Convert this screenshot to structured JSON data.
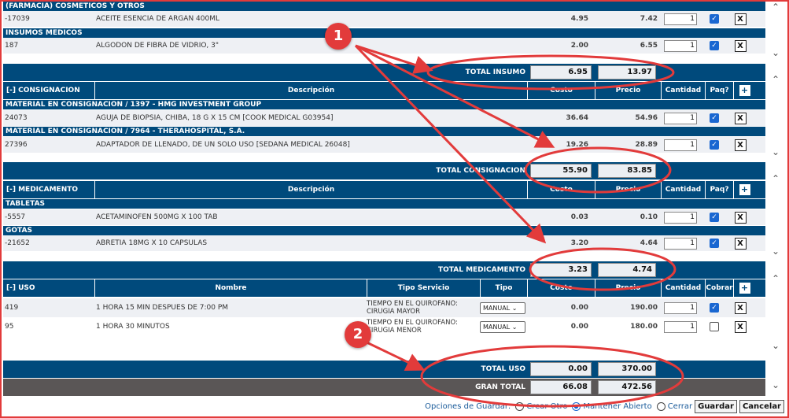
{
  "sections": {
    "cosmeticos": {
      "category": "(FARMACIA) COSMETICOS Y OTROS",
      "items": [
        {
          "code": "-17039",
          "desc": "ACEITE ESENCIA DE ARGAN 400ML",
          "cost": "4.95",
          "price": "7.42",
          "qty": "1",
          "paq": true
        }
      ]
    },
    "insumos": {
      "category": "INSUMOS MEDICOS",
      "items": [
        {
          "code": "187",
          "desc": "ALGODON DE FIBRA DE VIDRIO, 3\"",
          "cost": "2.00",
          "price": "6.55",
          "qty": "1",
          "paq": true
        }
      ],
      "total_label": "TOTAL INSUMO",
      "total_cost": "6.95",
      "total_price": "13.97"
    },
    "consignacion": {
      "header": [
        "[-] CONSIGNACION",
        "Descripción",
        "Costo",
        "Precio",
        "Cantidad",
        "Paq?",
        "+"
      ],
      "groups": [
        {
          "category": "MATERIAL EN CONSIGNACION / 1397 - HMG INVESTMENT GROUP",
          "item": {
            "code": "24073",
            "desc": "AGUJA DE BIOPSIA, CHIBA, 18 G X 15 CM [COOK MEDICAL G03954]",
            "cost": "36.64",
            "price": "54.96",
            "qty": "1",
            "paq": true
          }
        },
        {
          "category": "MATERIAL EN CONSIGNACION / 7964 - THERAHOSPITAL, S.A.",
          "item": {
            "code": "27396",
            "desc": "ADAPTADOR DE LLENADO, DE UN SOLO USO [SEDANA MEDICAL 26048]",
            "cost": "19.26",
            "price": "28.89",
            "qty": "1",
            "paq": true
          }
        }
      ],
      "total_label": "TOTAL CONSIGNACION",
      "total_cost": "55.90",
      "total_price": "83.85"
    },
    "medicamento": {
      "header": [
        "[-] MEDICAMENTO",
        "Descripción",
        "Costo",
        "Precio",
        "Cantidad",
        "Paq?",
        "+"
      ],
      "groups": [
        {
          "category": "TABLETAS",
          "item": {
            "code": "-5557",
            "desc": "ACETAMINOFEN 500MG X 100 TAB",
            "cost": "0.03",
            "price": "0.10",
            "qty": "1",
            "paq": true
          }
        },
        {
          "category": "GOTAS",
          "item": {
            "code": "-21652",
            "desc": "ABRETIA 18MG X 10 CAPSULAS",
            "cost": "3.20",
            "price": "4.64",
            "qty": "1",
            "paq": true
          }
        }
      ],
      "total_label": "TOTAL MEDICAMENTO",
      "total_cost": "3.23",
      "total_price": "4.74"
    },
    "uso": {
      "header": [
        "[-] USO",
        "Nombre",
        "Tipo Servicio",
        "Tipo",
        "Costo",
        "Precio",
        "Cantidad",
        "Cobrar",
        "+"
      ],
      "items": [
        {
          "code": "419",
          "name": "1 HORA 15 MIN DESPUES DE 7:00 PM",
          "service_1": "TIEMPO EN EL QUIROFANO:",
          "service_2": "CIRUGIA MAYOR",
          "tipo": "MANUAL",
          "cost": "0.00",
          "price": "190.00",
          "qty": "1",
          "cobrar": true
        },
        {
          "code": "95",
          "name": "1 HORA 30 MINUTOS",
          "service_1": "TIEMPO EN EL QUIROFANO:",
          "service_2": "CIRUGIA MENOR",
          "tipo": "MANUAL",
          "cost": "0.00",
          "price": "180.00",
          "qty": "1",
          "cobrar": false
        }
      ],
      "total_label": "TOTAL USO",
      "total_cost": "0.00",
      "total_price": "370.00"
    }
  },
  "gran_total": {
    "label": "GRAN TOTAL",
    "cost": "66.08",
    "price": "472.56"
  },
  "save_options": {
    "label": "Opciones de Guardar:",
    "options": [
      "Crear Otro",
      "Mantener Abierto",
      "Cerrar"
    ],
    "selected": "Mantener Abierto",
    "save_button": "Guardar",
    "cancel_button": "Cancelar"
  },
  "annotations": {
    "badge_1": "1",
    "badge_2": "2",
    "color": "#e23b3b"
  },
  "colors": {
    "header_blue": "#004a7c",
    "gran_total_gray": "#5a5656",
    "checkbox_blue": "#1a67d1"
  }
}
